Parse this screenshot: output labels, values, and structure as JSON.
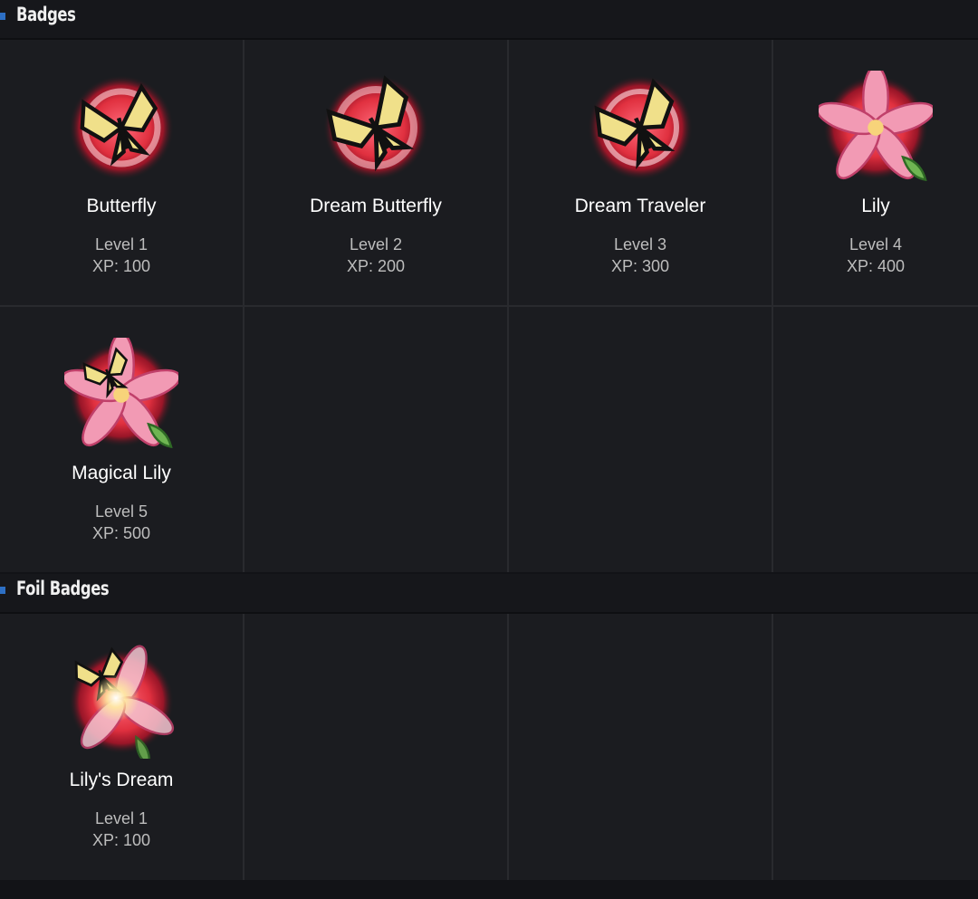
{
  "badges_section": {
    "title": "Badges",
    "items": [
      {
        "name": "Butterfly",
        "level": "Level 1",
        "xp": "XP: 100",
        "icon": "butterfly-badge-icon"
      },
      {
        "name": "Dream Butterfly",
        "level": "Level 2",
        "xp": "XP: 200",
        "icon": "dream-butterfly-badge-icon"
      },
      {
        "name": "Dream Traveler",
        "level": "Level 3",
        "xp": "XP: 300",
        "icon": "dream-traveler-badge-icon"
      },
      {
        "name": "Lily",
        "level": "Level 4",
        "xp": "XP: 400",
        "icon": "lily-badge-icon"
      },
      {
        "name": "Magical Lily",
        "level": "Level 5",
        "xp": "XP: 500",
        "icon": "magical-lily-badge-icon"
      }
    ]
  },
  "foil_section": {
    "title": "Foil Badges",
    "items": [
      {
        "name": "Lily's Dream",
        "level": "Level 1",
        "xp": "XP: 100",
        "icon": "lilys-dream-badge-icon"
      }
    ]
  },
  "colors": {
    "accent": "#2d6fc4",
    "background": "#1b1c20",
    "text": "#ffffff",
    "subtext": "#bdbdbd"
  }
}
